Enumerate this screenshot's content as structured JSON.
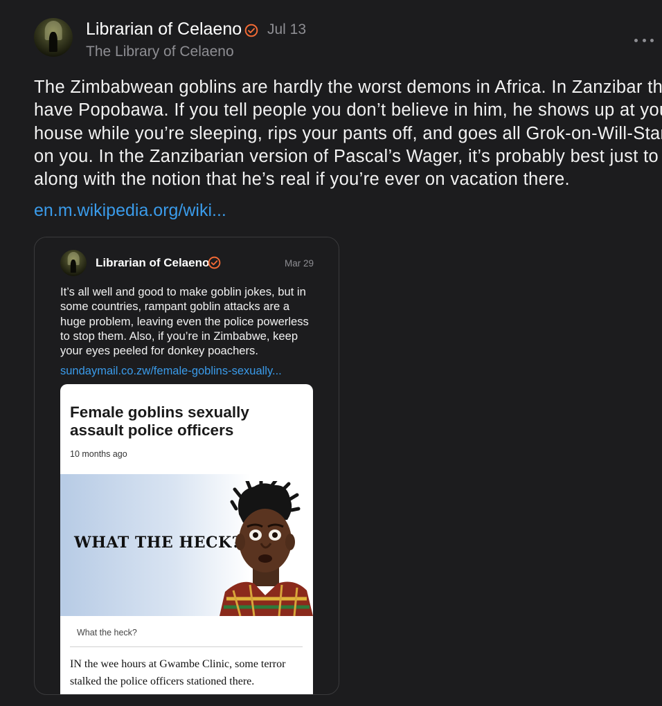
{
  "post": {
    "author": "Librarian of Celaeno",
    "date": "Jul 13",
    "handle": "The Library of Celaeno",
    "body_lines": [
      "The Zimbabwean goblins are hardly the worst demons in Africa. In Zanzibar they",
      "have Popobawa. If you tell people you don’t believe in him, he shows up at your",
      "house while you’re sleeping, rips your pants off, and goes all Grok-on-Will-Stancil",
      "on you. In the Zanzibarian version of Pascal’s Wager, it’s probably best just to go",
      "along with the notion that he’s real if you’re ever on vacation there."
    ],
    "link_text": "en.m.wikipedia.org/wiki..."
  },
  "quoted": {
    "author": "Librarian of Celaeno",
    "date": "Mar 29",
    "body_lines": [
      "It’s all well and good to make goblin jokes, but in",
      "some countries, rampant goblin attacks are a",
      "huge problem, leaving even the police powerless",
      "to stop them.  Also, if you’re in Zimbabwe, keep",
      "your eyes peeled for donkey poachers."
    ],
    "link_text": "sundaymail.co.zw/female-goblins-sexually..."
  },
  "article": {
    "title": "Female goblins sexually assault police officers",
    "time": "10 months ago",
    "image_text": "WHAT THE HECK?",
    "caption": "What the heck?",
    "lead_lines": [
      "IN the wee hours at Gwambe Clinic, some terror",
      "stalked the police officers stationed there."
    ]
  },
  "colors": {
    "background": "#1c1c1e",
    "link": "#3a9bea",
    "verified_badge": "#f26a35",
    "muted": "#8e8e93"
  },
  "icons": {
    "verified": "verified-badge-icon",
    "more": "more-options-icon"
  }
}
